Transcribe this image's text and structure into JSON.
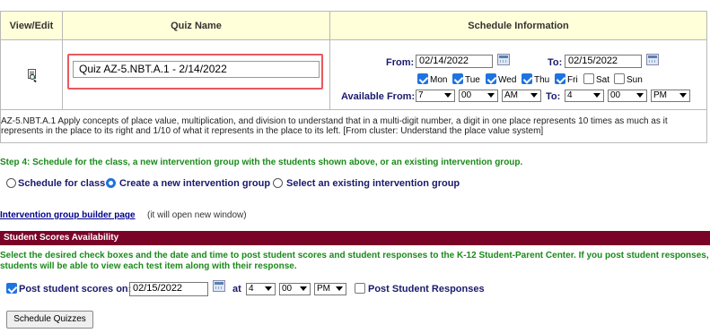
{
  "table": {
    "headers": {
      "view_edit": "View/Edit",
      "quiz_name": "Quiz Name",
      "schedule": "Schedule Information"
    },
    "quiz_name_value": "Quiz AZ-5.NBT.A.1 - 2/14/2022",
    "from_label": "From:",
    "from_date": "02/14/2022",
    "to_label": "To:",
    "to_date": "02/15/2022",
    "days": [
      {
        "label": "Mon",
        "checked": true
      },
      {
        "label": "Tue",
        "checked": true
      },
      {
        "label": "Wed",
        "checked": true
      },
      {
        "label": "Thu",
        "checked": true
      },
      {
        "label": "Fri",
        "checked": true
      },
      {
        "label": "Sat",
        "checked": false
      },
      {
        "label": "Sun",
        "checked": false
      }
    ],
    "available_from_label": "Available From:",
    "from_hour": "7",
    "from_min": "00",
    "from_ampm": "AM",
    "to_label2": "To:",
    "to_hour": "4",
    "to_min": "00",
    "to_ampm": "PM",
    "description": "AZ-5.NBT.A.1 Apply concepts of place value, multiplication, and division to understand that in a multi-digit number, a digit in one place represents 10 times as much as it represents in the place to its right and 1/10 of what it represents in the place to its left. [From cluster: Understand the place value system]"
  },
  "step4": "Step 4:  Schedule for the class, a new intervention group with the students shown above, or an existing intervention group.",
  "radios": [
    {
      "label": "Schedule for class",
      "selected": false
    },
    {
      "label": "Create a new intervention group",
      "selected": true
    },
    {
      "label": "Select an existing intervention group",
      "selected": false
    }
  ],
  "link": {
    "text": "Intervention group builder page",
    "note": "(it will open new window)"
  },
  "banner": "Student Scores Availability",
  "instructions": "Select the desired check boxes and the date and time to post student scores and student responses to the K-12 Student-Parent Center. If you post student responses, students will be able to view each test item along with their response.",
  "post": {
    "label": "Post student scores on:",
    "date": "02/15/2022",
    "at": "at",
    "hour": "4",
    "min": "00",
    "ampm": "PM",
    "responses_label": "Post Student Responses"
  },
  "button": "Schedule Quizzes"
}
